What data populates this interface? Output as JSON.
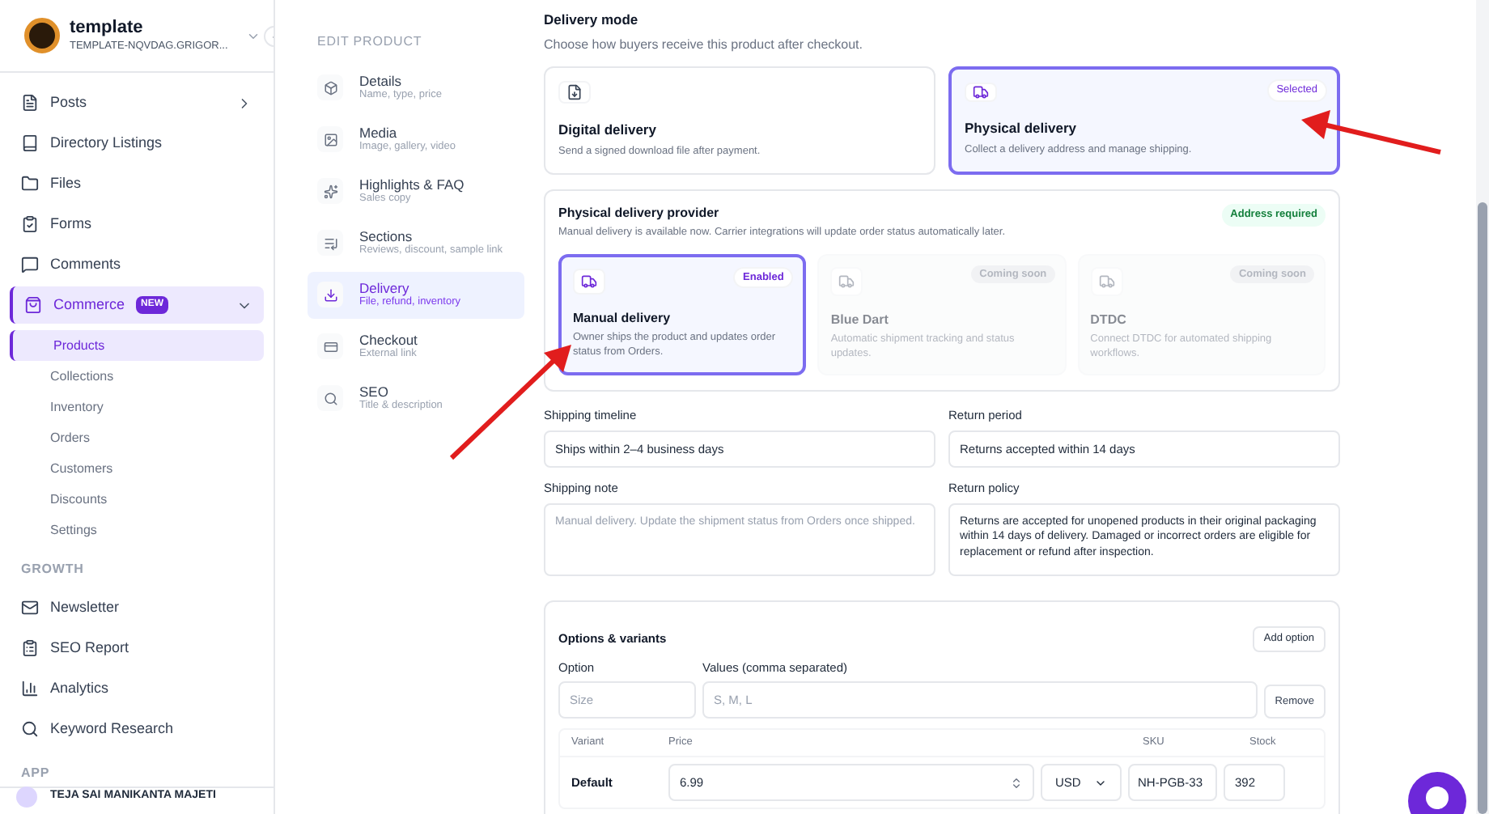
{
  "workspace": {
    "name": "template",
    "domain": "TEMPLATE-NQVDAG.GRIGOR..."
  },
  "sidebar": {
    "items": [
      {
        "label": "Posts",
        "kind": "item",
        "expanded": false,
        "selected": false
      },
      {
        "label": "Directory Listings",
        "kind": "item",
        "selected": false
      },
      {
        "label": "Files",
        "kind": "item",
        "selected": false
      },
      {
        "label": "Forms",
        "kind": "item",
        "selected": false
      },
      {
        "label": "Comments",
        "kind": "item",
        "selected": false
      },
      {
        "label": "Commerce",
        "kind": "item",
        "badge": "NEW",
        "expanded": true,
        "selected": true,
        "children": [
          {
            "label": "Products",
            "selected": true
          },
          {
            "label": "Collections",
            "selected": false
          },
          {
            "label": "Inventory",
            "selected": false
          },
          {
            "label": "Orders",
            "selected": false
          },
          {
            "label": "Customers",
            "selected": false
          },
          {
            "label": "Discounts",
            "selected": false
          },
          {
            "label": "Settings",
            "selected": false
          }
        ]
      },
      {
        "label": "GROWTH",
        "kind": "heading"
      },
      {
        "label": "Newsletter",
        "kind": "item",
        "selected": false
      },
      {
        "label": "SEO Report",
        "kind": "item",
        "selected": false
      },
      {
        "label": "Analytics",
        "kind": "item",
        "selected": false
      },
      {
        "label": "Keyword Research",
        "kind": "item",
        "selected": false
      },
      {
        "label": "APP",
        "kind": "heading"
      }
    ],
    "user": {
      "name": "TEJA SAI MANIKANTA MAJETI"
    }
  },
  "edit_nav": {
    "title": "EDIT PRODUCT",
    "items": [
      {
        "label": "Details",
        "sublabel": "Name, type, price",
        "selected": false
      },
      {
        "label": "Media",
        "sublabel": "Image, gallery, video",
        "selected": false
      },
      {
        "label": "Highlights & FAQ",
        "sublabel": "Sales copy",
        "selected": false
      },
      {
        "label": "Sections",
        "sublabel": "Reviews, discount, sample link",
        "selected": false
      },
      {
        "label": "Delivery",
        "sublabel": "File, refund, inventory",
        "selected": true
      },
      {
        "label": "Checkout",
        "sublabel": "External link",
        "selected": false
      },
      {
        "label": "SEO",
        "sublabel": "Title & description",
        "selected": false
      }
    ]
  },
  "delivery_mode": {
    "title": "Delivery mode",
    "subtitle": "Choose how buyers receive this product after checkout.",
    "options": [
      {
        "kind": "digital",
        "title": "Digital delivery",
        "description": "Send a signed download file after payment.",
        "selected": false
      },
      {
        "kind": "physical",
        "title": "Physical delivery",
        "description": "Collect a delivery address and manage shipping.",
        "selected": true,
        "badge": "Selected"
      }
    ]
  },
  "provider": {
    "title": "Physical delivery provider",
    "subtitle": "Manual delivery is available now. Carrier integrations will update order status automatically later.",
    "badge": "Address required",
    "options": [
      {
        "title": "Manual delivery",
        "description": "Owner ships the product and updates order status from Orders.",
        "status": "Enabled",
        "selected": true,
        "disabled": false
      },
      {
        "title": "Blue Dart",
        "description": "Automatic shipment tracking and status updates.",
        "status": "Coming soon",
        "selected": false,
        "disabled": true
      },
      {
        "title": "DTDC",
        "description": "Connect DTDC for automated shipping workflows.",
        "status": "Coming soon",
        "selected": false,
        "disabled": true
      }
    ]
  },
  "fields": [
    {
      "label": "Shipping timeline",
      "value": "Ships within 2–4 business days",
      "kind": "input"
    },
    {
      "label": "Return period",
      "value": "Returns accepted within 14 days",
      "kind": "input"
    },
    {
      "label": "Shipping note",
      "placeholder": "Manual delivery. Update the shipment status from Orders once shipped.",
      "kind": "textarea"
    },
    {
      "label": "Return policy",
      "value": "Returns are accepted for unopened products in their original packaging within 14 days of delivery. Damaged or incorrect orders are eligible for replacement or refund after inspection.",
      "kind": "textarea"
    }
  ],
  "options_variants": {
    "title": "Options & variants",
    "add_button": "Add option",
    "option_label": "Option",
    "values_label": "Values (comma separated)",
    "option_placeholder": "Size",
    "values_placeholder": "S, M, L",
    "remove_button": "Remove",
    "columns": [
      "Variant",
      "Price",
      "SKU",
      "Stock"
    ],
    "rows": [
      {
        "variant": "Default",
        "price": "6.99",
        "currency": "USD",
        "sku": "NH-PGB-33",
        "stock": "392"
      }
    ]
  }
}
